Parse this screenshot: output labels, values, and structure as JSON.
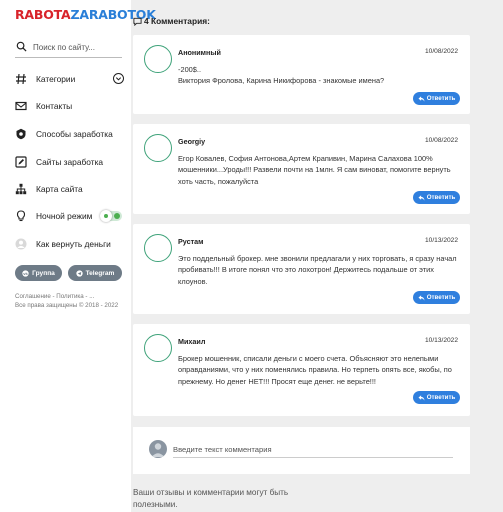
{
  "logo": {
    "part1": "RABOTA",
    "part2": "ZARABOTOK",
    "color1": "#d8232a",
    "color2": "#2a7fd8"
  },
  "search": {
    "placeholder": "Поиск по сайту...",
    "icon": "search-icon"
  },
  "nav": [
    {
      "label": "Категории",
      "icon": "hash-icon"
    },
    {
      "label": "Контакты",
      "icon": "mail-icon"
    },
    {
      "label": "Способы заработка",
      "icon": "cog-shield-icon"
    },
    {
      "label": "Сайты заработка",
      "icon": "edit-icon"
    },
    {
      "label": "Карта сайта",
      "icon": "sitemap-icon"
    },
    {
      "label": "Ночной режим",
      "icon": "bulb-icon"
    },
    {
      "label": "Как вернуть деньги",
      "icon": "user-icon"
    }
  ],
  "social": {
    "group": "Группа",
    "telegram": "Telegram"
  },
  "footer": {
    "links": "Соглашение - Политика - ...",
    "copyright": "Все права защищены © 2018 - 2022"
  },
  "comments_title": "4 Комментария:",
  "reply_label": "Ответить",
  "comments": [
    {
      "name": "Анонимный",
      "date": "10/08/2022",
      "text": "-200$..\nВиктория Фролова, Карина Никифорова - знакомые имена?"
    },
    {
      "name": "Georgiy",
      "date": "10/08/2022",
      "text": "Егор Ковалев, София Антонова,Артем Крапивин, Марина Салахова 100% мошенники...Уроды!!! Развели почти на 1млн. Я сам виноват, помогите вернуть хоть часть, пожалуйста"
    },
    {
      "name": "Рустам",
      "date": "10/13/2022",
      "text": "Это поддельный брокер. мне звонили предлагали у них торговать, я сразу начал пробивать!!! В итоге понял что это лохотрон! Держитесь подальше от этих клоунов."
    },
    {
      "name": "Михаил",
      "date": "10/13/2022",
      "text": "Брокер мошенник, списали деньги с моего счета. Объясняют это нелепыми оправданиями, что у них поменялись правила. Но терпеть опять все, якобы, по прежнему. Но денег НЕТ!!! Просят еще денег. не верьте!!!"
    }
  ],
  "comment_input": {
    "placeholder": "Введите текст комментария"
  },
  "bottom_text": "Ваши отзывы и комментарии могут быть полезными."
}
